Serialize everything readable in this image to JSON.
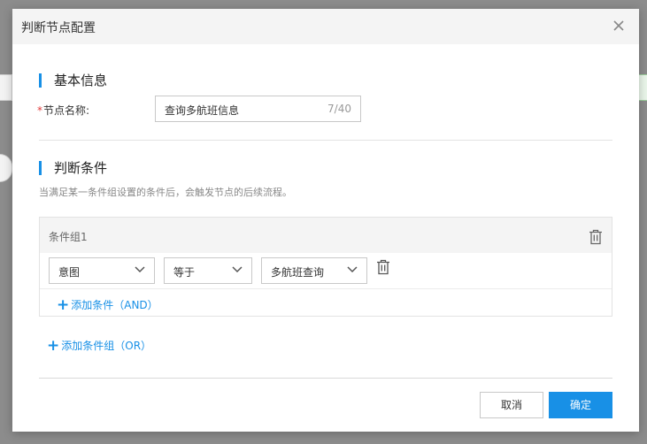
{
  "dialog": {
    "title": "判断节点配置"
  },
  "basic_info": {
    "section_title": "基本信息",
    "node_name_required": "*",
    "node_name_label": "节点名称:",
    "node_name_value": "查询多航班信息",
    "node_name_counter": "7/40"
  },
  "conditions": {
    "section_title": "判断条件",
    "hint": "当满足某一条件组设置的条件后，会触发节点的后续流程。",
    "groups": [
      {
        "title": "条件组1",
        "rows": [
          {
            "field": "意图",
            "operator": "等于",
            "value": "多航班查询"
          }
        ],
        "add_condition_label": "添加条件（AND）"
      }
    ],
    "add_group_label": "添加条件组（OR）"
  },
  "footer": {
    "cancel_label": "取消",
    "ok_label": "确定"
  },
  "colors": {
    "accent": "#1890e6",
    "required": "#e23c3c",
    "header_bg": "#f4f4f4",
    "overlay": "#8c8c8c"
  }
}
